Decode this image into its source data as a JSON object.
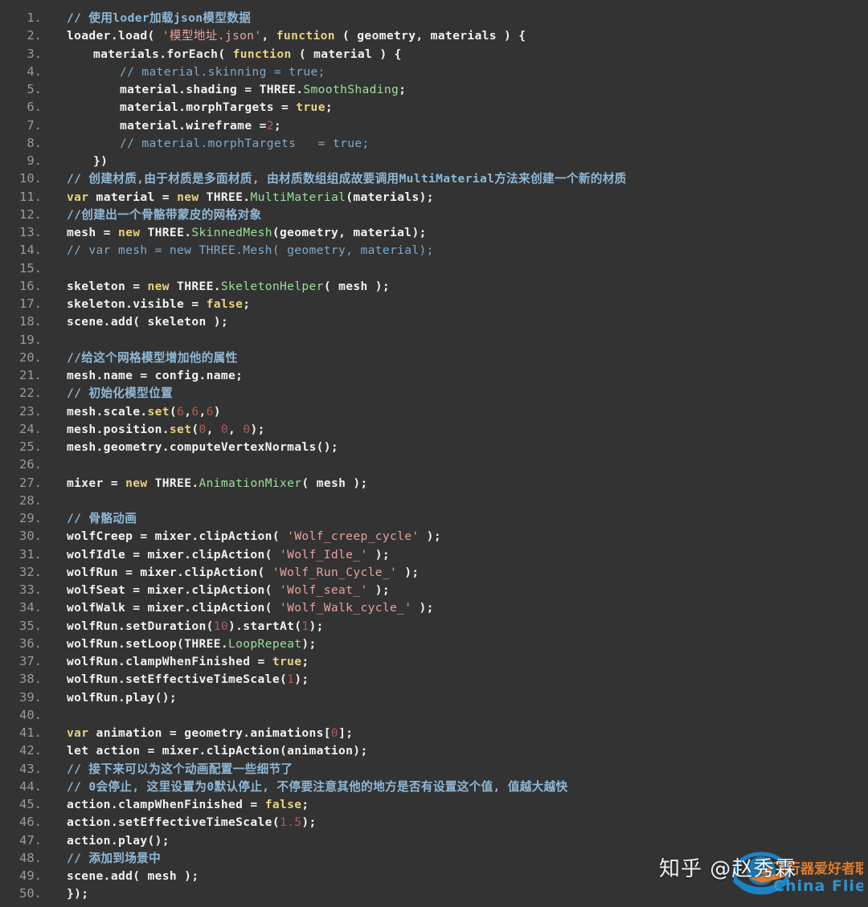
{
  "editor": {
    "background": "#333333",
    "line_number_color": "#9a9a9a",
    "text_color": "#f2f2f2",
    "total_lines": 50,
    "colors": {
      "comment": "#8fb8d6",
      "keyword": "#e8d37a",
      "string": "#e8a0a0",
      "number": "#b05a5a",
      "class": "#9adf9a"
    }
  },
  "lines": [
    {
      "n": "1.",
      "indent": 0,
      "tokens": [
        {
          "t": "comment",
          "v": "// 使用loder加载json模型数据"
        }
      ]
    },
    {
      "n": "2.",
      "indent": 0,
      "tokens": [
        {
          "t": "plain",
          "v": "loader.load( "
        },
        {
          "t": "string",
          "v": "'模型地址.json'"
        },
        {
          "t": "plain",
          "v": ", "
        },
        {
          "t": "keyword",
          "v": "function"
        },
        {
          "t": "plain",
          "v": " ( geometry, materials ) {"
        }
      ]
    },
    {
      "n": "3.",
      "indent": 1,
      "tokens": [
        {
          "t": "plain",
          "v": "materials.forEach( "
        },
        {
          "t": "keyword",
          "v": "function"
        },
        {
          "t": "plain",
          "v": " ( material ) {"
        }
      ]
    },
    {
      "n": "4.",
      "indent": 2,
      "tokens": [
        {
          "t": "comment-dim",
          "v": "// material.skinning = true;"
        }
      ]
    },
    {
      "n": "5.",
      "indent": 2,
      "tokens": [
        {
          "t": "plain",
          "v": "material.shading = THREE."
        },
        {
          "t": "class",
          "v": "SmoothShading"
        },
        {
          "t": "plain",
          "v": ";"
        }
      ]
    },
    {
      "n": "6.",
      "indent": 2,
      "tokens": [
        {
          "t": "plain",
          "v": "material.morphTargets = "
        },
        {
          "t": "bool",
          "v": "true"
        },
        {
          "t": "plain",
          "v": ";"
        }
      ]
    },
    {
      "n": "7.",
      "indent": 2,
      "tokens": [
        {
          "t": "plain",
          "v": "material.wireframe ="
        },
        {
          "t": "number",
          "v": "2"
        },
        {
          "t": "plain",
          "v": ";"
        }
      ]
    },
    {
      "n": "8.",
      "indent": 2,
      "tokens": [
        {
          "t": "comment-dim",
          "v": "// material.morphTargets   = true;"
        }
      ]
    },
    {
      "n": "9.",
      "indent": 1,
      "tokens": [
        {
          "t": "plain",
          "v": "})"
        }
      ]
    },
    {
      "n": "10.",
      "indent": 0,
      "tokens": [
        {
          "t": "comment",
          "v": "// 创建材质,由于材质是多面材质, 由材质数组组成故要调用MultiMaterial方法来创建一个新的材质"
        }
      ]
    },
    {
      "n": "11.",
      "indent": 0,
      "tokens": [
        {
          "t": "keyword",
          "v": "var"
        },
        {
          "t": "plain",
          "v": " material = "
        },
        {
          "t": "keyword",
          "v": "new"
        },
        {
          "t": "plain",
          "v": " THREE."
        },
        {
          "t": "class",
          "v": "MultiMaterial"
        },
        {
          "t": "plain",
          "v": "(materials);"
        }
      ]
    },
    {
      "n": "12.",
      "indent": 0,
      "tokens": [
        {
          "t": "comment",
          "v": "//创建出一个骨骼带蒙皮的网格对象"
        }
      ]
    },
    {
      "n": "13.",
      "indent": 0,
      "tokens": [
        {
          "t": "plain",
          "v": "mesh = "
        },
        {
          "t": "keyword",
          "v": "new"
        },
        {
          "t": "plain",
          "v": " THREE."
        },
        {
          "t": "class",
          "v": "SkinnedMesh"
        },
        {
          "t": "plain",
          "v": "(geometry, material);"
        }
      ]
    },
    {
      "n": "14.",
      "indent": 0,
      "tokens": [
        {
          "t": "comment-dim",
          "v": "// var mesh = new THREE.Mesh( geometry, material);"
        }
      ]
    },
    {
      "n": "15.",
      "indent": 0,
      "tokens": []
    },
    {
      "n": "16.",
      "indent": 0,
      "tokens": [
        {
          "t": "plain",
          "v": "skeleton = "
        },
        {
          "t": "keyword",
          "v": "new"
        },
        {
          "t": "plain",
          "v": " THREE."
        },
        {
          "t": "class",
          "v": "SkeletonHelper"
        },
        {
          "t": "plain",
          "v": "( mesh );"
        }
      ]
    },
    {
      "n": "17.",
      "indent": 0,
      "tokens": [
        {
          "t": "plain",
          "v": "skeleton.visible = "
        },
        {
          "t": "bool",
          "v": "false"
        },
        {
          "t": "plain",
          "v": ";"
        }
      ]
    },
    {
      "n": "18.",
      "indent": 0,
      "tokens": [
        {
          "t": "plain",
          "v": "scene.add( skeleton );"
        }
      ]
    },
    {
      "n": "19.",
      "indent": 0,
      "tokens": []
    },
    {
      "n": "20.",
      "indent": 0,
      "tokens": [
        {
          "t": "comment",
          "v": "//给这个网格模型增加他的属性"
        }
      ]
    },
    {
      "n": "21.",
      "indent": 0,
      "tokens": [
        {
          "t": "plain",
          "v": "mesh.name = config.name;"
        }
      ]
    },
    {
      "n": "22.",
      "indent": 0,
      "tokens": [
        {
          "t": "comment",
          "v": "// 初始化模型位置"
        }
      ]
    },
    {
      "n": "23.",
      "indent": 0,
      "tokens": [
        {
          "t": "plain",
          "v": "mesh.scale."
        },
        {
          "t": "method",
          "v": "set"
        },
        {
          "t": "plain",
          "v": "("
        },
        {
          "t": "number",
          "v": "6"
        },
        {
          "t": "plain",
          "v": ","
        },
        {
          "t": "number",
          "v": "6"
        },
        {
          "t": "plain",
          "v": ","
        },
        {
          "t": "number",
          "v": "6"
        },
        {
          "t": "plain",
          "v": ")"
        }
      ]
    },
    {
      "n": "24.",
      "indent": 0,
      "tokens": [
        {
          "t": "plain",
          "v": "mesh.position."
        },
        {
          "t": "method",
          "v": "set"
        },
        {
          "t": "plain",
          "v": "("
        },
        {
          "t": "number",
          "v": "0"
        },
        {
          "t": "plain",
          "v": ", "
        },
        {
          "t": "number",
          "v": "0"
        },
        {
          "t": "plain",
          "v": ", "
        },
        {
          "t": "number",
          "v": "0"
        },
        {
          "t": "plain",
          "v": ");"
        }
      ]
    },
    {
      "n": "25.",
      "indent": 0,
      "tokens": [
        {
          "t": "plain",
          "v": "mesh.geometry.computeVertexNormals();"
        }
      ]
    },
    {
      "n": "26.",
      "indent": 0,
      "tokens": []
    },
    {
      "n": "27.",
      "indent": 0,
      "tokens": [
        {
          "t": "plain",
          "v": "mixer = "
        },
        {
          "t": "keyword",
          "v": "new"
        },
        {
          "t": "plain",
          "v": " THREE."
        },
        {
          "t": "class",
          "v": "AnimationMixer"
        },
        {
          "t": "plain",
          "v": "( mesh );"
        }
      ]
    },
    {
      "n": "28.",
      "indent": 0,
      "tokens": []
    },
    {
      "n": "29.",
      "indent": 0,
      "tokens": [
        {
          "t": "comment",
          "v": "// 骨骼动画"
        }
      ]
    },
    {
      "n": "30.",
      "indent": 0,
      "tokens": [
        {
          "t": "plain",
          "v": "wolfCreep = mixer.clipAction( "
        },
        {
          "t": "string",
          "v": "'Wolf_creep_cycle'"
        },
        {
          "t": "plain",
          "v": " );"
        }
      ]
    },
    {
      "n": "31.",
      "indent": 0,
      "tokens": [
        {
          "t": "plain",
          "v": "wolfIdle = mixer.clipAction( "
        },
        {
          "t": "string",
          "v": "'Wolf_Idle_'"
        },
        {
          "t": "plain",
          "v": " );"
        }
      ]
    },
    {
      "n": "32.",
      "indent": 0,
      "tokens": [
        {
          "t": "plain",
          "v": "wolfRun = mixer.clipAction( "
        },
        {
          "t": "string",
          "v": "'Wolf_Run_Cycle_'"
        },
        {
          "t": "plain",
          "v": " );"
        }
      ]
    },
    {
      "n": "33.",
      "indent": 0,
      "tokens": [
        {
          "t": "plain",
          "v": "wolfSeat = mixer.clipAction( "
        },
        {
          "t": "string",
          "v": "'Wolf_seat_'"
        },
        {
          "t": "plain",
          "v": " );"
        }
      ]
    },
    {
      "n": "34.",
      "indent": 0,
      "tokens": [
        {
          "t": "plain",
          "v": "wolfWalk = mixer.clipAction( "
        },
        {
          "t": "string",
          "v": "'Wolf_Walk_cycle_'"
        },
        {
          "t": "plain",
          "v": " );"
        }
      ]
    },
    {
      "n": "35.",
      "indent": 0,
      "tokens": [
        {
          "t": "plain",
          "v": "wolfRun.setDuration("
        },
        {
          "t": "number",
          "v": "10"
        },
        {
          "t": "plain",
          "v": ").startAt("
        },
        {
          "t": "number",
          "v": "1"
        },
        {
          "t": "plain",
          "v": ");"
        }
      ]
    },
    {
      "n": "36.",
      "indent": 0,
      "tokens": [
        {
          "t": "plain",
          "v": "wolfRun.setLoop(THREE."
        },
        {
          "t": "class",
          "v": "LoopRepeat"
        },
        {
          "t": "plain",
          "v": ");"
        }
      ]
    },
    {
      "n": "37.",
      "indent": 0,
      "tokens": [
        {
          "t": "plain",
          "v": "wolfRun.clampWhenFinished = "
        },
        {
          "t": "bool",
          "v": "true"
        },
        {
          "t": "plain",
          "v": ";"
        }
      ]
    },
    {
      "n": "38.",
      "indent": 0,
      "tokens": [
        {
          "t": "plain",
          "v": "wolfRun.setEffectiveTimeScale("
        },
        {
          "t": "number",
          "v": "1"
        },
        {
          "t": "plain",
          "v": ");"
        }
      ]
    },
    {
      "n": "39.",
      "indent": 0,
      "tokens": [
        {
          "t": "plain",
          "v": "wolfRun.play();"
        }
      ]
    },
    {
      "n": "40.",
      "indent": 0,
      "tokens": []
    },
    {
      "n": "41.",
      "indent": 0,
      "tokens": [
        {
          "t": "keyword",
          "v": "var"
        },
        {
          "t": "plain",
          "v": " animation = geometry.animations["
        },
        {
          "t": "number",
          "v": "0"
        },
        {
          "t": "plain",
          "v": "];"
        }
      ]
    },
    {
      "n": "42.",
      "indent": 0,
      "tokens": [
        {
          "t": "plain",
          "v": "let action = mixer.clipAction(animation);"
        }
      ]
    },
    {
      "n": "43.",
      "indent": 0,
      "tokens": [
        {
          "t": "comment",
          "v": "// 接下来可以为这个动画配置一些细节了"
        }
      ]
    },
    {
      "n": "44.",
      "indent": 0,
      "tokens": [
        {
          "t": "comment",
          "v": "// 0会停止, 这里设置为0默认停止, 不停要注意其他的地方是否有设置这个值, 值越大越快"
        }
      ]
    },
    {
      "n": "45.",
      "indent": 0,
      "tokens": [
        {
          "t": "plain",
          "v": "action.clampWhenFinished = "
        },
        {
          "t": "bool",
          "v": "false"
        },
        {
          "t": "plain",
          "v": ";"
        }
      ]
    },
    {
      "n": "46.",
      "indent": 0,
      "tokens": [
        {
          "t": "plain",
          "v": "action.setEffectiveTimeScale("
        },
        {
          "t": "number",
          "v": "1.5"
        },
        {
          "t": "plain",
          "v": ");"
        }
      ]
    },
    {
      "n": "47.",
      "indent": 0,
      "tokens": [
        {
          "t": "plain",
          "v": "action.play();"
        }
      ]
    },
    {
      "n": "48.",
      "indent": 0,
      "tokens": [
        {
          "t": "comment",
          "v": "// 添加到场景中"
        }
      ]
    },
    {
      "n": "49.",
      "indent": 0,
      "tokens": [
        {
          "t": "plain",
          "v": "scene.add( mesh );"
        }
      ]
    },
    {
      "n": "50.",
      "indent": -1,
      "tokens": [
        {
          "t": "plain",
          "v": "});"
        }
      ]
    }
  ],
  "watermark": {
    "zhihu_text": "知乎 @赵秀霖",
    "logo_cn_text": "飞行器爱好者联盟",
    "logo_en_text": "China Flier",
    "logo_blue": "#1b84c4",
    "logo_orange": "#e07b2a"
  }
}
